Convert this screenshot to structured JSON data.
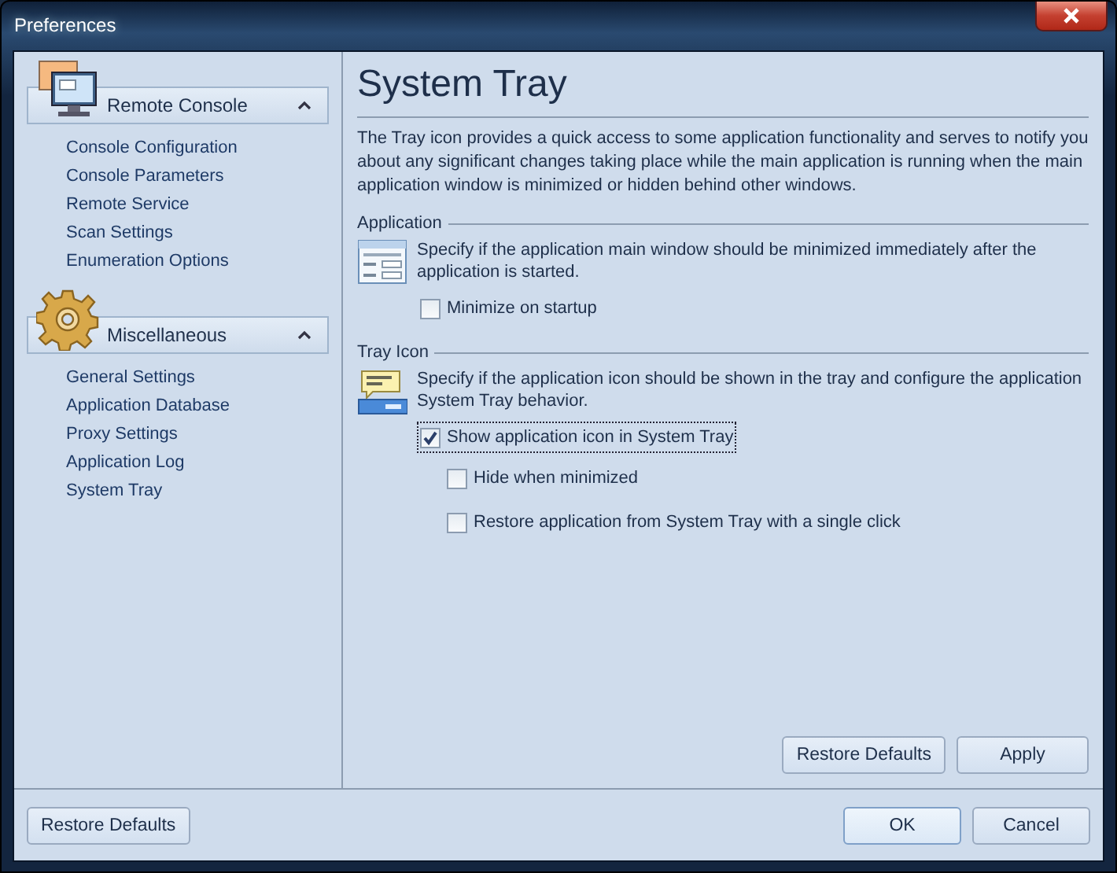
{
  "window": {
    "title": "Preferences"
  },
  "sidebar": {
    "groups": [
      {
        "title": "Remote Console",
        "expanded": true,
        "items": [
          "Console Configuration",
          "Console Parameters",
          "Remote Service",
          "Scan Settings",
          "Enumeration Options"
        ]
      },
      {
        "title": "Miscellaneous",
        "expanded": true,
        "items": [
          "General Settings",
          "Application Database",
          "Proxy Settings",
          "Application Log",
          "System Tray"
        ]
      }
    ]
  },
  "page": {
    "title": "System Tray",
    "description": "The Tray icon provides a quick access to some application functionality and serves to notify you about any significant changes taking place while the main application is running when the main application window is minimized or hidden behind other windows.",
    "sections": [
      {
        "title": "Application",
        "description": "Specify if the application main window should be minimized immediately after the application is started.",
        "options": [
          {
            "label": "Minimize on startup",
            "checked": false,
            "focused": false
          }
        ]
      },
      {
        "title": "Tray Icon",
        "description": "Specify if the application icon should be shown in the tray and configure the application System Tray behavior.",
        "options": [
          {
            "label": "Show application icon in System Tray",
            "checked": true,
            "focused": true,
            "children": [
              {
                "label": "Hide when minimized",
                "checked": false,
                "focused": false
              },
              {
                "label": "Restore application from System Tray with a single click",
                "checked": false,
                "focused": false
              }
            ]
          }
        ]
      }
    ],
    "buttons": [
      "Restore Defaults",
      "Apply"
    ]
  },
  "footer": {
    "left_button": "Restore Defaults",
    "buttons": [
      "OK",
      "Cancel"
    ]
  }
}
